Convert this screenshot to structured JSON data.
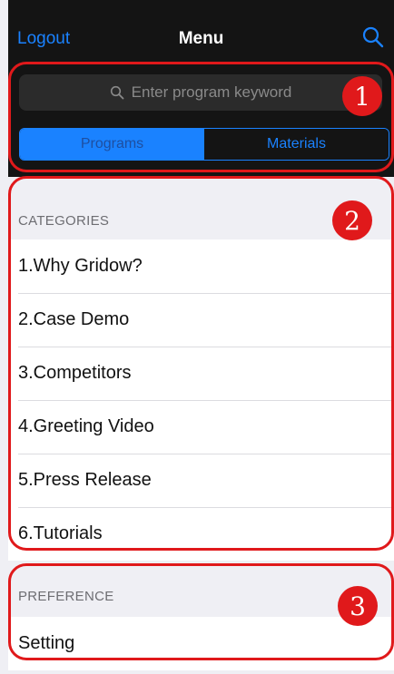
{
  "nav": {
    "left_label": "Logout",
    "title": "Menu",
    "right_icon": "search-icon"
  },
  "search": {
    "placeholder": "Enter program keyword"
  },
  "segmented": {
    "items": [
      "Programs",
      "Materials"
    ],
    "selected": "Programs"
  },
  "categories": {
    "header": "CATEGORIES",
    "items": [
      "1.Why Gridow?",
      "2.Case Demo",
      "3.Competitors",
      "4.Greeting Video",
      "5.Press Release",
      "6.Tutorials"
    ]
  },
  "preference": {
    "header": "PREFERENCE",
    "items": [
      "Setting"
    ]
  },
  "annotations": {
    "badges": [
      "1",
      "2",
      "3"
    ],
    "color": "#e0191b"
  },
  "colors": {
    "accent": "#1a82ff",
    "topbar": "#141414"
  }
}
